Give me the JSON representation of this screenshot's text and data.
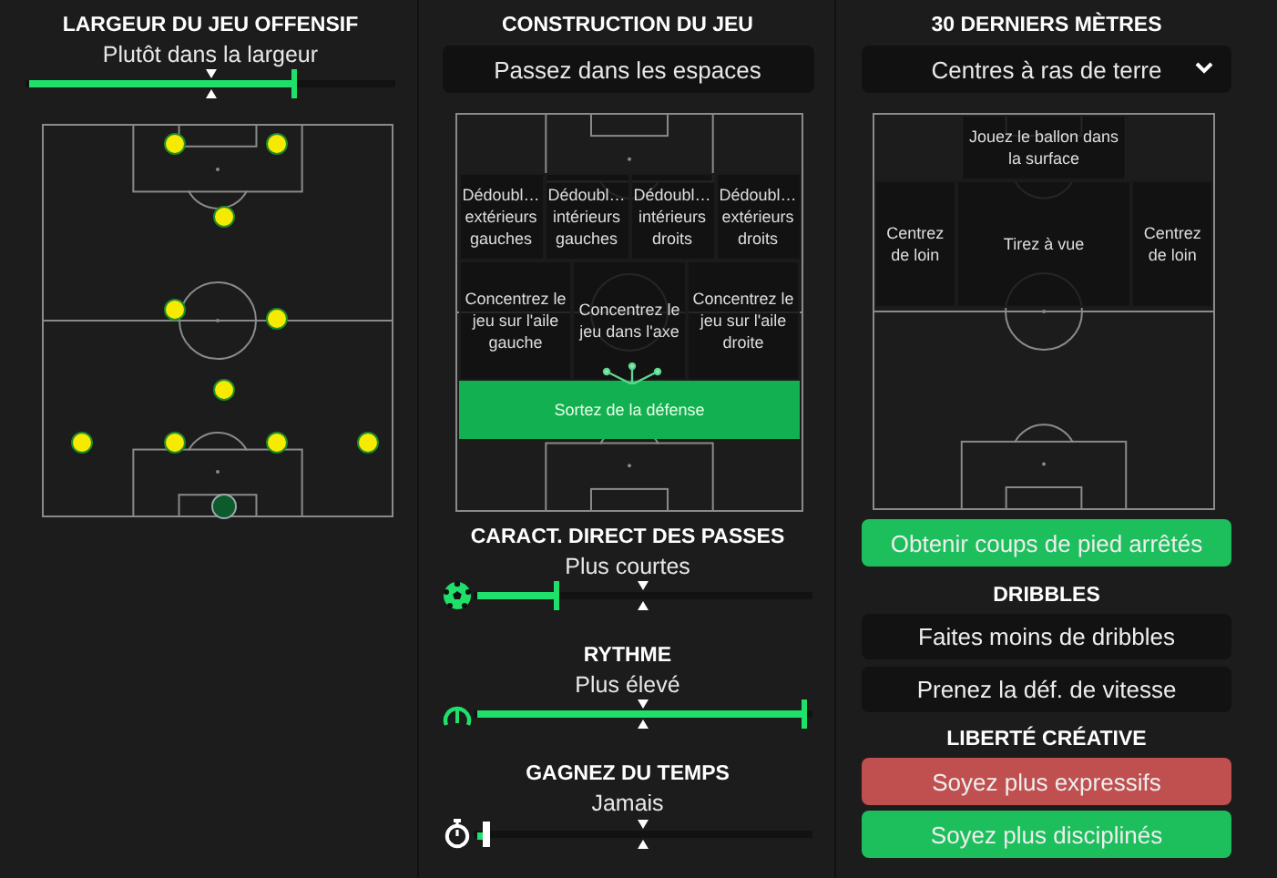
{
  "offensive_width": {
    "title": "LARGEUR DU JEU OFFENSIF",
    "value": "Plutôt dans la largeur",
    "level": 0.74,
    "players": [
      {
        "kind": "outfield"
      },
      {
        "kind": "outfield"
      },
      {
        "kind": "outfield"
      },
      {
        "kind": "outfield"
      },
      {
        "kind": "outfield"
      },
      {
        "kind": "outfield"
      },
      {
        "kind": "outfield"
      },
      {
        "kind": "outfield"
      },
      {
        "kind": "outfield"
      },
      {
        "kind": "outfield"
      },
      {
        "kind": "goalkeeper"
      }
    ]
  },
  "build_up": {
    "title": "CONSTRUCTION DU JEU",
    "dropdown": "Passez dans les espaces",
    "zone_rows": [
      [
        {
          "label": "Dédoubl… extérieurs gauches",
          "selected": false
        },
        {
          "label": "Dédoubl… intérieurs gauches",
          "selected": false
        },
        {
          "label": "Dédoubl… intérieurs droits",
          "selected": false
        },
        {
          "label": "Dédoubl… extérieurs droits",
          "selected": false
        }
      ],
      [
        {
          "label": "Concentrez le jeu sur l'aile gauche",
          "selected": false
        },
        {
          "label": "Concentrez le jeu dans l'axe",
          "selected": false
        },
        {
          "label": "Concentrez le jeu sur l'aile droite",
          "selected": false
        }
      ],
      [
        {
          "label": "Sortez de la défense",
          "selected": true
        }
      ]
    ]
  },
  "passing_sliders": [
    {
      "title": "CARACT. DIRECT DES PASSES",
      "value": "Plus courtes",
      "level": 0.25
    },
    {
      "title": "RYTHME",
      "value": "Plus élevé",
      "level": 1
    },
    {
      "title": "GAGNEZ DU TEMPS",
      "value": "Jamais",
      "level": 0
    }
  ],
  "final_third": {
    "title": "30 DERNIERS MÈTRES",
    "dropdown": "Centres à ras de terre",
    "zone_rows": [
      [
        {
          "label": "Jouez le ballon dans la surface",
          "selected": false
        }
      ],
      [
        {
          "label": "Centrez de loin",
          "selected": false
        },
        {
          "label": "Tirez à vue",
          "selected": false
        },
        {
          "label": "Centrez de loin",
          "selected": false
        }
      ]
    ],
    "button": {
      "label": "Obtenir coups de pied arrêtés",
      "selected": true
    }
  },
  "dribbles": {
    "title": "DRIBBLES",
    "options": [
      {
        "label": "Faites moins de dribbles",
        "selected": false
      },
      {
        "label": "Prenez la déf. de vitesse",
        "selected": false
      }
    ]
  },
  "creative_freedom": {
    "title": "LIBERTÉ CRÉATIVE",
    "options": [
      {
        "label": "Soyez plus expressifs",
        "selected": false,
        "blocked": true
      },
      {
        "label": "Soyez plus disciplinés",
        "selected": true,
        "blocked": false
      }
    ]
  }
}
